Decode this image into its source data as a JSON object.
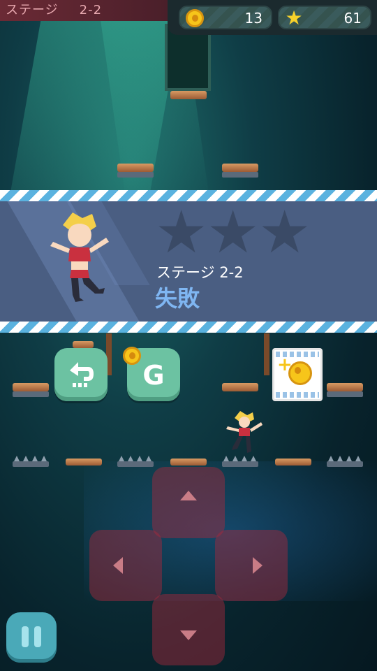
{
  "header": {
    "stage_label": "ステージ",
    "stage_number": "2-2"
  },
  "hud": {
    "coins": "13",
    "stars": "61",
    "coin_icon": "coin-icon",
    "star_icon": "star-icon"
  },
  "result": {
    "stage_line": "ステージ 2-2",
    "status": "失敗",
    "stars_earned": 0,
    "stars_total": 3
  },
  "buttons": {
    "back_icon": "return-arrow-icon",
    "retry_letter": "G",
    "retry_cost_icon": "coin-icon",
    "video_icon": "video-film-coin-icon"
  },
  "controls": {
    "up": "up-arrow-icon",
    "down": "down-arrow-icon",
    "left": "left-arrow-icon",
    "right": "right-arrow-icon",
    "pause": "pause-icon"
  },
  "colors": {
    "banner": "#4a5e82",
    "fail_text": "#7fb6f2",
    "button_green": "#6cc2a2",
    "dpad": "#aa283c",
    "coin": "#f7c51a"
  }
}
